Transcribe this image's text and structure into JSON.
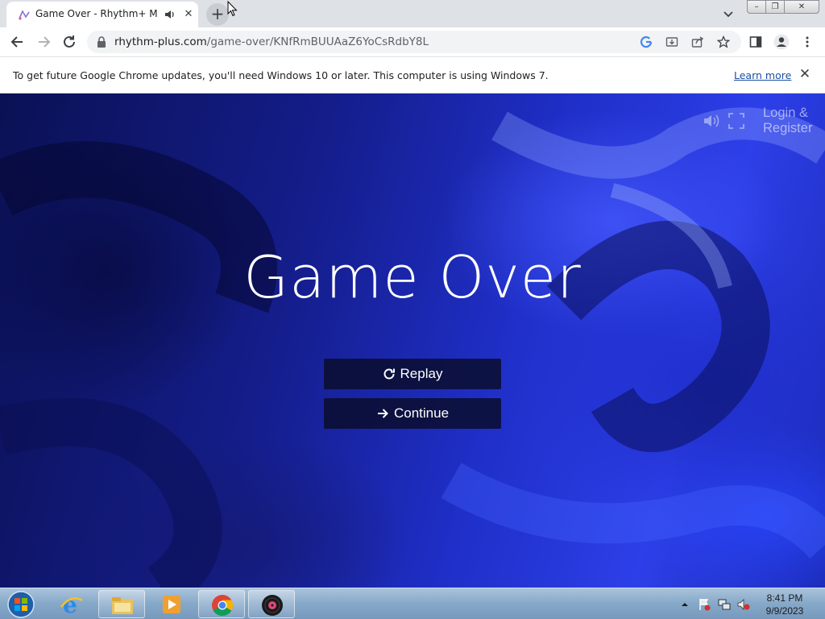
{
  "browser": {
    "tab_title": "Game Over - Rhythm+ Musi",
    "new_tab_label": "+",
    "url_host": "rhythm-plus.com",
    "url_path": "/game-over/KNfRmBUUAaZ6YoCsRdbY8L",
    "tab_close": "✕",
    "window_buttons": [
      "–",
      "❐",
      "✕"
    ]
  },
  "infobar": {
    "message": "To get future Google Chrome updates, you'll need Windows 10 or later. This computer is using Windows 7.",
    "link": "Learn more",
    "close": "✕"
  },
  "page": {
    "login_label": "Login & Register",
    "title": "Game Over",
    "buttons": {
      "replay": "Replay",
      "continue": "Continue"
    }
  },
  "taskbar": {
    "apps": [
      "internet-explorer",
      "file-explorer",
      "media-player",
      "chrome",
      "rhythm-plus"
    ],
    "clock_time": "8:41 PM",
    "clock_date": "9/9/2023"
  },
  "colors": {
    "page_blue": "#1f2fc8",
    "button_bg": "#0a0c28",
    "link_blue": "#1a4fa0"
  }
}
